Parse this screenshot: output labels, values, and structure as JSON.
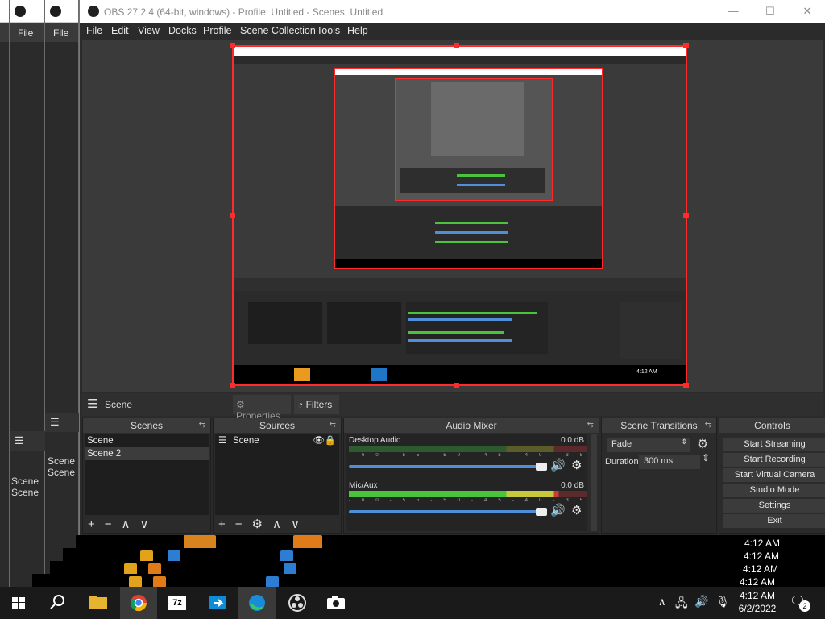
{
  "windows_behind": [
    {
      "short_title": "O",
      "file_label": "File"
    },
    {
      "short_title": "O",
      "file_label": "File"
    }
  ],
  "main": {
    "title": "OBS 27.2.4 (64-bit, windows) - Profile: Untitled - Scenes: Untitled",
    "controls": {
      "minimize": "—",
      "maximize": "☐",
      "close": "✕"
    },
    "menu": [
      "File",
      "Edit",
      "View",
      "Docks",
      "Profile",
      "Scene Collection",
      "Tools",
      "Help"
    ]
  },
  "dock_toolbar": {
    "scene_label": "Scene",
    "properties_label": "Properties",
    "filters_label": "Filters"
  },
  "scenes": {
    "header": "Scenes",
    "items": [
      "Scene",
      "Scene 2"
    ],
    "selected": 1
  },
  "sources": {
    "header": "Sources",
    "items": [
      "Scene"
    ]
  },
  "audio_mixer": {
    "header": "Audio Mixer",
    "channels": [
      {
        "name": "Desktop Audio",
        "db": "0.0 dB",
        "level": 0.0,
        "volume": 1.0
      },
      {
        "name": "Mic/Aux",
        "db": "0.0 dB",
        "level": 0.86,
        "volume": 1.0
      }
    ],
    "scale": [
      "-60",
      "-55",
      "-50",
      "-45",
      "-40",
      "-35",
      "-30",
      "-25",
      "-20",
      "-15",
      "-10",
      "-5",
      "0"
    ]
  },
  "transitions": {
    "header": "Scene Transitions",
    "selected": "Fade",
    "duration_label": "Duration",
    "duration_value": "300 ms"
  },
  "controls": {
    "header": "Controls",
    "buttons": [
      "Start Streaming",
      "Start Recording",
      "Start Virtual Camera",
      "Studio Mode",
      "Settings",
      "Exit"
    ]
  },
  "left_echoes": {
    "scenes_header": "Scene",
    "items": [
      "Scene",
      "Scene"
    ]
  },
  "echo_times": [
    "4:12 AM",
    "4:12 AM",
    "4:12 AM",
    "4:12 AM"
  ],
  "taskbar": {
    "time": "4:12 AM",
    "date": "6/2/2022",
    "notification_count": "2",
    "apps": [
      "start",
      "search",
      "file-explorer",
      "chrome",
      "7zip",
      "remote-desktop",
      "edge",
      "obs",
      "camera"
    ]
  },
  "colors": {
    "selection_red": "#ff2a2a",
    "meter_green": "#49c43c",
    "meter_yellow": "#c8c83c",
    "meter_red": "#c83c3c",
    "volume_blue": "#4f8fda"
  }
}
